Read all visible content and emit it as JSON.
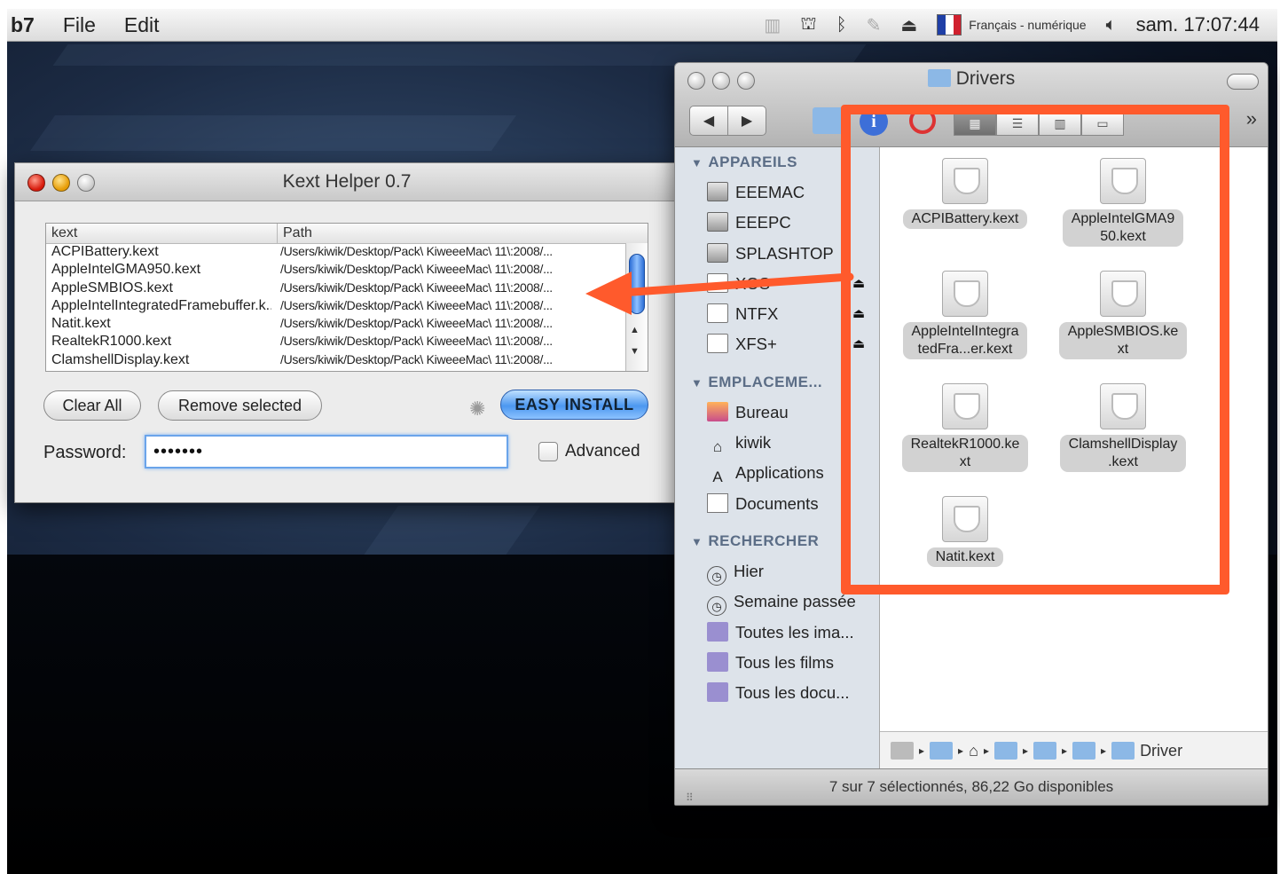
{
  "menubar": {
    "app": "b7",
    "items": [
      "File",
      "Edit"
    ],
    "keyboard": "Français - numérique",
    "clock": "sam. 17:07:44"
  },
  "kext_helper": {
    "title": "Kext Helper 0.7",
    "columns": [
      "kext",
      "Path"
    ],
    "rows": [
      {
        "kext": "ACPIBattery.kext",
        "path": "/Users/kiwik/Desktop/Pack\\ KiweeeMac\\ 11\\:2008/..."
      },
      {
        "kext": "AppleIntelGMA950.kext",
        "path": "/Users/kiwik/Desktop/Pack\\ KiweeeMac\\ 11\\:2008/..."
      },
      {
        "kext": "AppleSMBIOS.kext",
        "path": "/Users/kiwik/Desktop/Pack\\ KiweeeMac\\ 11\\:2008/..."
      },
      {
        "kext": "AppleIntelIntegratedFramebuffer.k...",
        "path": "/Users/kiwik/Desktop/Pack\\ KiweeeMac\\ 11\\:2008/..."
      },
      {
        "kext": "Natit.kext",
        "path": "/Users/kiwik/Desktop/Pack\\ KiweeeMac\\ 11\\:2008/..."
      },
      {
        "kext": "RealtekR1000.kext",
        "path": "/Users/kiwik/Desktop/Pack\\ KiweeeMac\\ 11\\:2008/..."
      },
      {
        "kext": "ClamshellDisplay.kext",
        "path": "/Users/kiwik/Desktop/Pack\\ KiweeeMac\\ 11\\:2008/..."
      }
    ],
    "clear_all": "Clear All",
    "remove_selected": "Remove selected",
    "easy_install": "EASY INSTALL",
    "password_label": "Password:",
    "password_value": "•••••••",
    "advanced_label": "Advanced"
  },
  "finder": {
    "title": "Drivers",
    "sections": [
      {
        "label": "APPAREILS",
        "items": [
          {
            "label": "EEEMAC",
            "icon": "disk",
            "eject": false
          },
          {
            "label": "EEEPC",
            "icon": "disk",
            "eject": false
          },
          {
            "label": "SPLASHTOP",
            "icon": "disk",
            "eject": false
          },
          {
            "label": "XOS",
            "icon": "volume",
            "eject": true
          },
          {
            "label": "NTFX",
            "icon": "volume",
            "eject": true
          },
          {
            "label": "XFS+",
            "icon": "volume",
            "eject": true
          }
        ]
      },
      {
        "label": "EMPLACEME...",
        "items": [
          {
            "label": "Bureau",
            "icon": "desktop",
            "eject": false
          },
          {
            "label": "kiwik",
            "icon": "home",
            "eject": false
          },
          {
            "label": "Applications",
            "icon": "apps",
            "eject": false
          },
          {
            "label": "Documents",
            "icon": "document",
            "eject": false
          }
        ]
      },
      {
        "label": "RECHERCHER",
        "items": [
          {
            "label": "Hier",
            "icon": "clock",
            "eject": false
          },
          {
            "label": "Semaine passée",
            "icon": "clock",
            "eject": false
          },
          {
            "label": "Toutes les ima...",
            "icon": "smart-folder",
            "eject": false
          },
          {
            "label": "Tous les films",
            "icon": "smart-folder",
            "eject": false
          },
          {
            "label": "Tous les docu...",
            "icon": "smart-folder",
            "eject": false
          }
        ]
      }
    ],
    "files": [
      [
        "ACPIBattery.kext"
      ],
      [
        "AppleIntelGMA9",
        "50.kext"
      ],
      [
        "AppleIntelIntegra",
        "tedFra...er.kext"
      ],
      [
        "AppleSMBIOS.ke",
        "xt"
      ],
      [
        "RealtekR1000.ke",
        "xt"
      ],
      [
        "ClamshellDisplay",
        ".kext"
      ],
      [
        "Natit.kext"
      ]
    ],
    "path_last": "Driver",
    "status": "7 sur 7 sélectionnés, 86,22 Go disponibles"
  },
  "colors": {
    "highlight": "#ff5a2c",
    "selection_blue": "#4c97f0"
  }
}
